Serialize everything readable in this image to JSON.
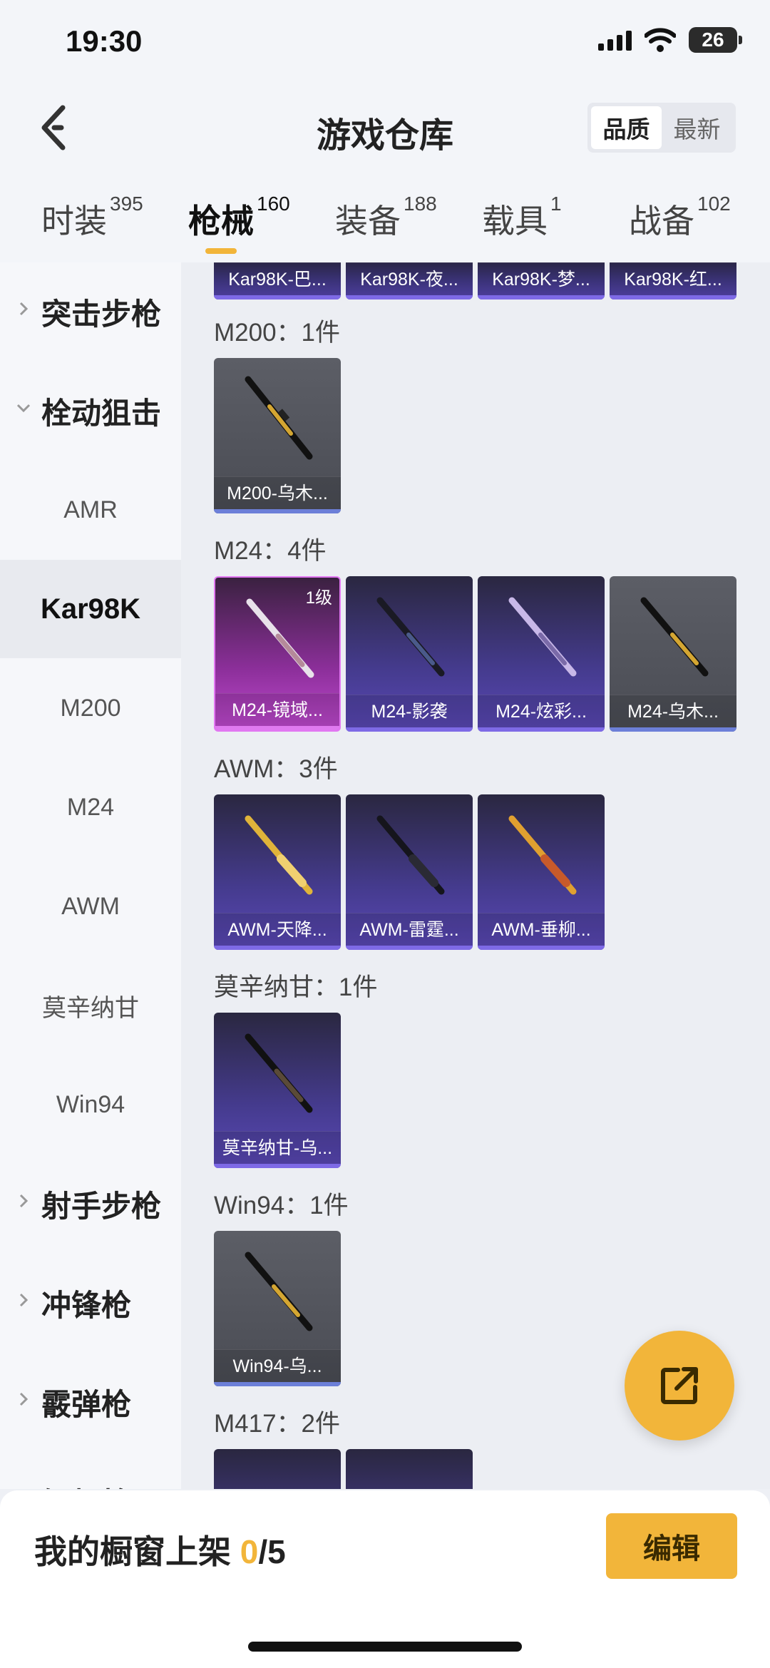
{
  "status": {
    "time": "19:30",
    "battery": "26"
  },
  "header": {
    "title": "游戏仓库",
    "sort_options": [
      "品质",
      "最新"
    ]
  },
  "tabs": [
    {
      "label": "时装",
      "count": "395"
    },
    {
      "label": "枪械",
      "count": "160"
    },
    {
      "label": "装备",
      "count": "188"
    },
    {
      "label": "载具",
      "count": "1"
    },
    {
      "label": "战备",
      "count": "102"
    }
  ],
  "sidebar": {
    "cat_assault": "突击步枪",
    "cat_bolt": "栓动狙击",
    "sub_amr": "AMR",
    "sub_kar98k": "Kar98K",
    "sub_m200": "M200",
    "sub_m24": "M24",
    "sub_awm": "AWM",
    "sub_mosin": "莫辛纳甘",
    "sub_win94": "Win94",
    "cat_marksman": "射手步枪",
    "cat_smg": "冲锋枪",
    "cat_shotgun": "霰弹枪",
    "cat_lmg": "轻机枪"
  },
  "sections": {
    "kar98k": {
      "items": [
        "Kar98K-巴...",
        "Kar98K-夜...",
        "Kar98K-梦...",
        "Kar98K-红..."
      ]
    },
    "m200": {
      "title": "M200：1件",
      "items": [
        "M200-乌木..."
      ]
    },
    "m24": {
      "title": "M24：4件",
      "level": "1级",
      "items": [
        "M24-镜域...",
        "M24-影袭",
        "M24-炫彩...",
        "M24-乌木..."
      ]
    },
    "awm": {
      "title": "AWM：3件",
      "items": [
        "AWM-天降...",
        "AWM-雷霆...",
        "AWM-垂柳..."
      ]
    },
    "mosin": {
      "title": "莫辛纳甘：1件",
      "items": [
        "莫辛纳甘-乌..."
      ]
    },
    "win94": {
      "title": "Win94：1件",
      "items": [
        "Win94-乌..."
      ]
    },
    "m417": {
      "title": "M417：2件"
    }
  },
  "bottom": {
    "label": "我的橱窗上架 ",
    "count": "0",
    "total": "/5",
    "edit": "编辑"
  }
}
